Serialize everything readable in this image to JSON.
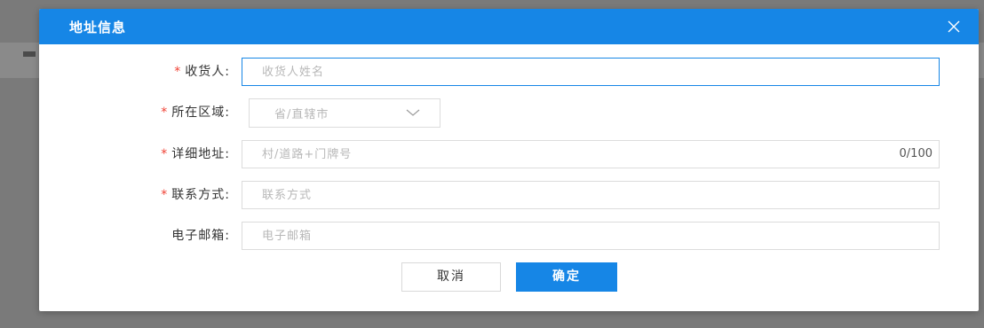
{
  "dialog": {
    "title": "地址信息",
    "close_icon": "close-icon"
  },
  "form": {
    "required_mark": "*",
    "receiver": {
      "label": "收货人:",
      "placeholder": "收货人姓名",
      "required": true
    },
    "region": {
      "label": "所在区域:",
      "value": "省/直辖市",
      "required": true,
      "icon": "chevron-down-icon"
    },
    "address": {
      "label": "详细地址:",
      "placeholder": "村/道路+门牌号",
      "counter": "0/100",
      "required": true
    },
    "contact": {
      "label": "联系方式:",
      "placeholder": "联系方式",
      "required": true
    },
    "email": {
      "label": "电子邮箱:",
      "placeholder": "电子邮箱",
      "required": false
    }
  },
  "buttons": {
    "cancel": "取消",
    "confirm": "确定"
  },
  "colors": {
    "primary": "#1686e6",
    "required": "#f04134",
    "overlay": "#7a7a7a"
  }
}
